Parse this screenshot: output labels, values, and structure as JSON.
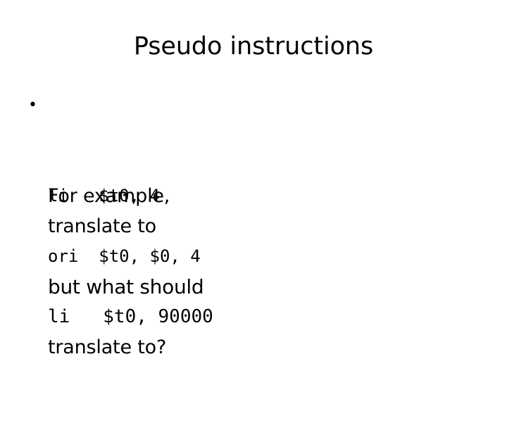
{
  "slide": {
    "title": "Pseudo instructions",
    "background_color": "#ffffff",
    "text_color": "#000000",
    "bullet_glyph": "•",
    "lines": [
      {
        "text": "For example,",
        "kind": "prose",
        "bulleted": true
      },
      {
        "text": "li   $t0, 4",
        "kind": "code",
        "bulleted": false
      },
      {
        "text": "translate to",
        "kind": "prose",
        "bulleted": false
      },
      {
        "text": "ori  $t0, $0, 4",
        "kind": "code",
        "bulleted": false
      },
      {
        "text": "but what should",
        "kind": "prose-emph",
        "bulleted": false
      },
      {
        "text": "li   $t0, 90000",
        "kind": "code-large",
        "bulleted": false
      },
      {
        "text": "translate to?",
        "kind": "prose",
        "bulleted": false
      }
    ]
  }
}
